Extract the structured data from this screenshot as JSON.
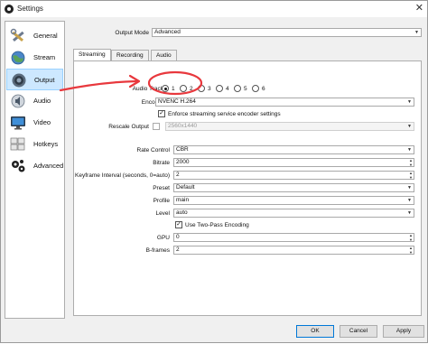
{
  "window": {
    "title": "Settings",
    "close_glyph": "✕"
  },
  "sidebar": {
    "items": [
      {
        "label": "General",
        "icon": "wrench-screwdriver-icon",
        "selected": false
      },
      {
        "label": "Stream",
        "icon": "globe-icon",
        "selected": false
      },
      {
        "label": "Output",
        "icon": "speaker-icon",
        "selected": true
      },
      {
        "label": "Audio",
        "icon": "audio-icon",
        "selected": false
      },
      {
        "label": "Video",
        "icon": "monitor-icon",
        "selected": false
      },
      {
        "label": "Hotkeys",
        "icon": "keyboard-icon",
        "selected": false
      },
      {
        "label": "Advanced",
        "icon": "gears-icon",
        "selected": false
      }
    ]
  },
  "output_mode": {
    "label": "Output Mode",
    "value": "Advanced"
  },
  "tabs": [
    "Streaming",
    "Recording",
    "Audio"
  ],
  "streaming": {
    "audio_track": {
      "label": "Audio Track",
      "options": [
        "1",
        "2",
        "3",
        "4",
        "5",
        "6"
      ],
      "selected": "1"
    },
    "encoder": {
      "label": "Encoder",
      "value": "NVENC H.264"
    },
    "enforce": {
      "label": "Enforce streaming service encoder settings",
      "checked": true
    },
    "rescale": {
      "label": "Rescale Output",
      "checked": false,
      "value": "2560x1440"
    },
    "rate_control": {
      "label": "Rate Control",
      "value": "CBR"
    },
    "bitrate": {
      "label": "Bitrate",
      "value": "2000"
    },
    "keyframe": {
      "label": "Keyframe Interval (seconds, 0=auto)",
      "value": "2"
    },
    "preset": {
      "label": "Preset",
      "value": "Default"
    },
    "profile": {
      "label": "Profile",
      "value": "main"
    },
    "level": {
      "label": "Level",
      "value": "auto"
    },
    "two_pass": {
      "label": "Use Two-Pass Encoding",
      "checked": true
    },
    "gpu": {
      "label": "GPU",
      "value": "0"
    },
    "bframes": {
      "label": "B-frames",
      "value": "2"
    }
  },
  "footer": {
    "ok": "OK",
    "cancel": "Cancel",
    "apply": "Apply"
  },
  "annotation": {
    "color": "#e8383d"
  }
}
